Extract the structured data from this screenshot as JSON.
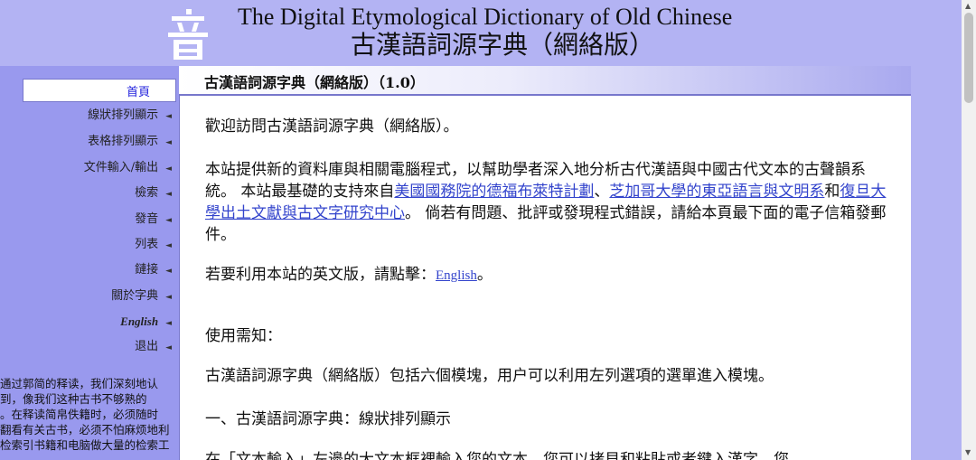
{
  "header": {
    "title_en": "The Digital Etymological Dictionary of Old Chinese",
    "title_zh": "古漢語詞源字典（網絡版）",
    "logo_char": "音"
  },
  "sidebar": {
    "home": "首頁",
    "items": [
      {
        "label": "線狀排列顯示"
      },
      {
        "label": "表格排列顯示"
      },
      {
        "label": "文件輸入/輸出"
      },
      {
        "label": "檢索"
      },
      {
        "label": "發音"
      },
      {
        "label": "列表"
      },
      {
        "label": "鏈接"
      },
      {
        "label": "關於字典"
      },
      {
        "label": "English"
      },
      {
        "label": "退出"
      }
    ],
    "arrow": "◄",
    "quote_lines": [
      "通过郭简的释读，我们深刻地认",
      "到，像我们这种古书不够熟的",
      "。在释读简帛佚籍时，必须随时",
      "翻看有关古书，必须不怕麻烦地利",
      "检索引书籍和电脑做大量的检索工"
    ]
  },
  "main": {
    "bar_title": "古漢語詞源字典（網絡版）（1.0）",
    "welcome": "歡迎訪問古漢語詞源字典（網絡版）。",
    "intro_1": "本站提供新的資料庫與相關電腦程式，以幫助學者深入地分析古代漢語與中國古代文本的古聲韻系統。 本站最基礎的支持來自",
    "link_1": "美國國務院的德福布萊特計劃",
    "sep_1": "、",
    "link_2": "芝加哥大學的東亞語言與文明系",
    "sep_2": "和",
    "link_3": "復旦大學出土文獻與古文字研究中心",
    "intro_2": "。 倘若有問題、批評或發現程式錯誤，請給本頁最下面的電子信箱發郵件。",
    "english_prefix": "若要利用本站的英文版，請點擊：",
    "english_link": "English",
    "english_suffix": "。",
    "usage_heading": "使用需知：",
    "usage_text": "古漢語詞源字典（網絡版）包括六個模塊，用户可以利用左列選項的選單進入模塊。",
    "section_1": "一、古漢語詞源字典：線狀排列顯示",
    "cut_line": "在「文本輸入」左邊的大文本框裡輸入您的文本，您可以拷貝和粘貼或者鍵入漢字。您"
  },
  "scrollbar": {
    "up": "▲",
    "down": "▼"
  }
}
